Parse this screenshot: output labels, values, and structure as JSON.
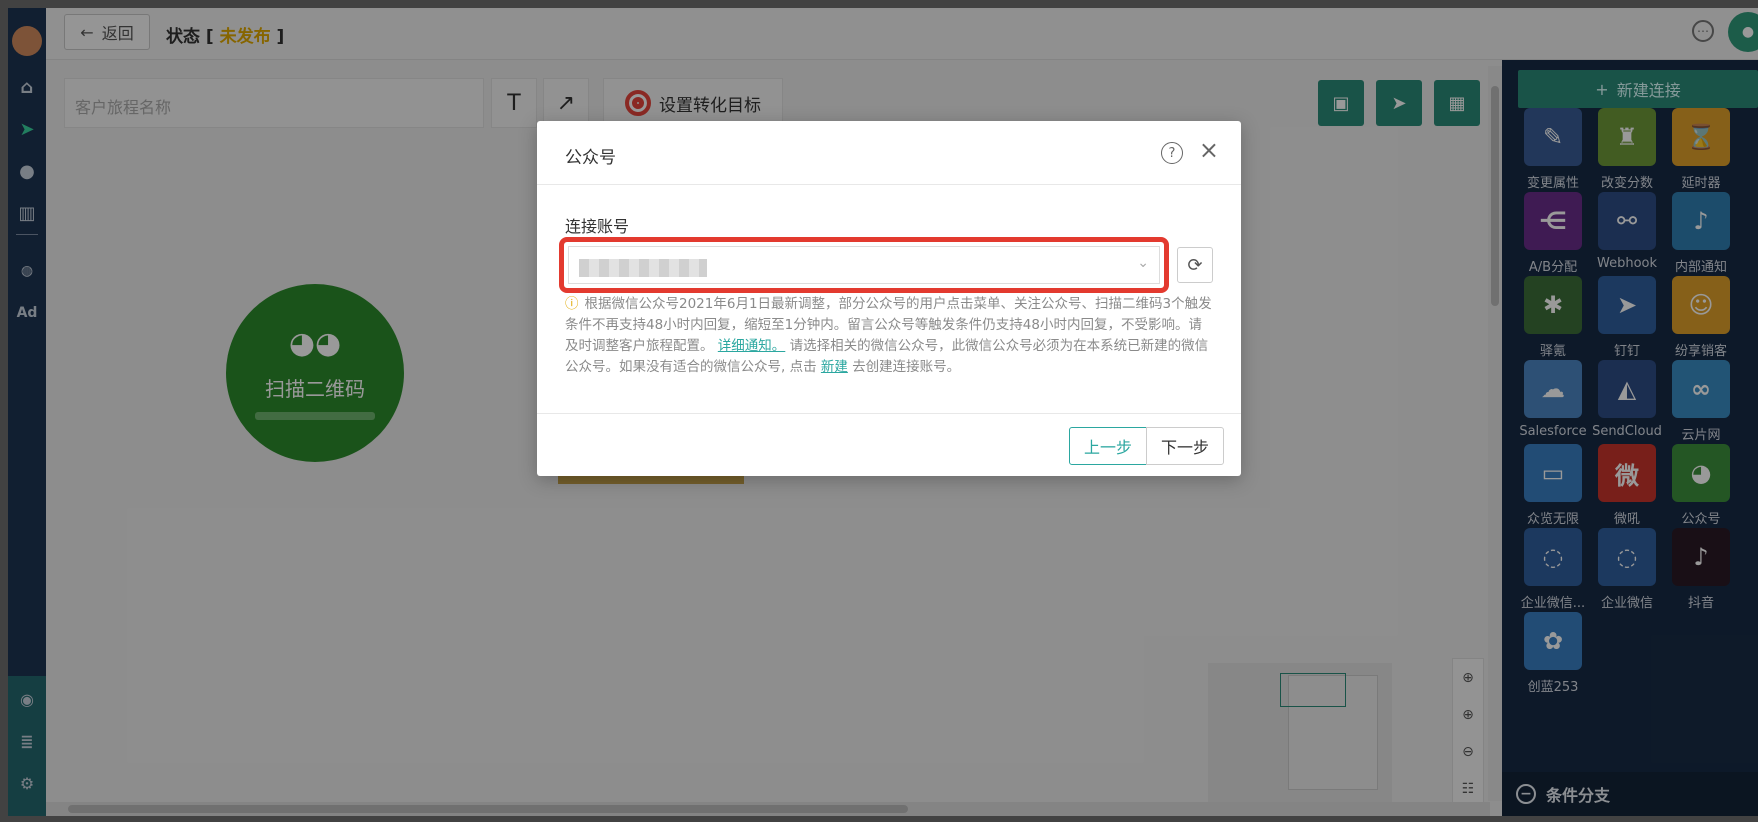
{
  "topbar": {
    "back_label": "返回",
    "status_prefix": "状态 [",
    "status_value": "未发布",
    "status_suffix": "]"
  },
  "toolbar": {
    "name_placeholder": "客户旅程名称",
    "text_tool": "T",
    "arrow_tool": "↗",
    "goal_label": "设置转化目标"
  },
  "canvas": {
    "node_label": "扫描二维码"
  },
  "panel": {
    "new_connection": "新建连接",
    "tiles": [
      {
        "label": "变更属性",
        "icon": "edit-icon",
        "color": "#3a5d96"
      },
      {
        "label": "改变分数",
        "icon": "trophy-icon",
        "color": "#6f9a3a"
      },
      {
        "label": "延时器",
        "icon": "hourglass-icon",
        "color": "#e0a12b"
      },
      {
        "label": "A/B分配",
        "icon": "split-icon",
        "color": "#6a2d8a"
      },
      {
        "label": "Webhook",
        "icon": "webhook-icon",
        "color": "#2e4d86"
      },
      {
        "label": "内部通知",
        "icon": "bell-icon",
        "color": "#2f7fb2"
      },
      {
        "label": "驿氪",
        "icon": "bug-icon",
        "color": "#3c6f3a"
      },
      {
        "label": "钉钉",
        "icon": "dingtalk-icon",
        "color": "#2f5f9e"
      },
      {
        "label": "纷享销客",
        "icon": "fxiaoke-icon",
        "color": "#e0a12b"
      },
      {
        "label": "Salesforce",
        "icon": "cloud-icon",
        "color": "#4c86c3"
      },
      {
        "label": "SendCloud",
        "icon": "sendcloud-icon",
        "color": "#2e4d86"
      },
      {
        "label": "云片网",
        "icon": "link-icon",
        "color": "#3a8dc3"
      },
      {
        "label": "众览无限",
        "icon": "zhonglan-icon",
        "color": "#3a7fc3"
      },
      {
        "label": "微吼",
        "icon": "weihou-icon",
        "color": "#c8342c"
      },
      {
        "label": "公众号",
        "icon": "wechat-icon",
        "color": "#3c8f3c"
      },
      {
        "label": "企业微信...",
        "icon": "wecom-icon",
        "color": "#2f5f9e"
      },
      {
        "label": "企业微信",
        "icon": "wecom-icon",
        "color": "#2f5f9e"
      },
      {
        "label": "抖音",
        "icon": "tiktok-icon",
        "color": "#2a1a26"
      },
      {
        "label": "创蓝253",
        "icon": "chuanglan-icon",
        "color": "#3a7fc3"
      }
    ],
    "branch_label": "条件分支"
  },
  "modal": {
    "title": "公众号",
    "field_label": "连接账号",
    "notice_part1": "根据微信公众号2021年6月1日最新调整，部分公众号的用户点击菜单、关注公众号、扫描二维码3个触发条件不再支持48小时内回复，缩短至1分钟内。留言公众号等触发条件仍支持48小时内回复，不受影响。请及时调整客户旅程配置。",
    "notice_link1": "详细通知。",
    "notice_part2": "请选择相关的微信公众号，此微信公众号必须为在本系统已新建的微信公众号。如果没有适合的微信公众号, 点击",
    "notice_link2": "新建",
    "notice_part3": "去创建连接账号。",
    "prev_label": "上一步",
    "next_label": "下一步"
  }
}
